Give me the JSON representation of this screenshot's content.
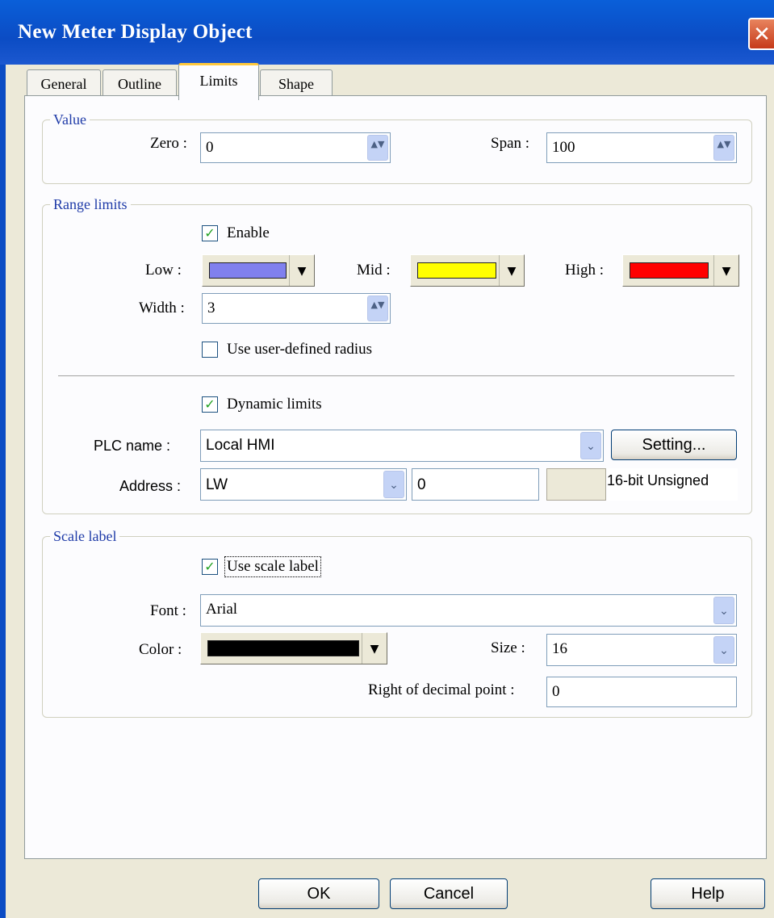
{
  "window": {
    "title": "New  Meter Display Object",
    "close_glyph": "✕"
  },
  "tabs": [
    {
      "label": "General"
    },
    {
      "label": "Outline"
    },
    {
      "label": "Limits"
    },
    {
      "label": "Shape"
    }
  ],
  "value_group": {
    "legend": "Value",
    "zero_label": "Zero :",
    "zero_value": "0",
    "span_label": "Span :",
    "span_value": "100"
  },
  "range_group": {
    "legend": "Range limits",
    "enable_label": "Enable",
    "enable_checked": true,
    "low_label": "Low :",
    "low_color": "#8080ee",
    "mid_label": "Mid :",
    "mid_color": "#ffff00",
    "high_label": "High :",
    "high_color": "#ff0000",
    "width_label": "Width :",
    "width_value": "3",
    "user_radius_label": "Use user-defined radius",
    "user_radius_checked": false,
    "dynamic_label": "Dynamic limits",
    "dynamic_checked": true,
    "plc_label": "PLC name :",
    "plc_value": "Local HMI",
    "setting_button": "Setting...",
    "address_label": "Address :",
    "address_device": "LW",
    "address_number": "0",
    "address_type": "16-bit Unsigned"
  },
  "scale_group": {
    "legend": "Scale label",
    "use_label": "Use scale label",
    "use_checked": true,
    "font_label": "Font :",
    "font_value": "Arial",
    "color_label": "Color :",
    "color_value": "#000000",
    "size_label": "Size :",
    "size_value": "16",
    "decimal_label": "Right of decimal point :",
    "decimal_value": "0"
  },
  "footer": {
    "ok": "OK",
    "cancel": "Cancel",
    "help": "Help"
  },
  "glyphs": {
    "check": "✓",
    "spin": "▲▼",
    "dropdown": "▼",
    "combo": "⌄"
  }
}
